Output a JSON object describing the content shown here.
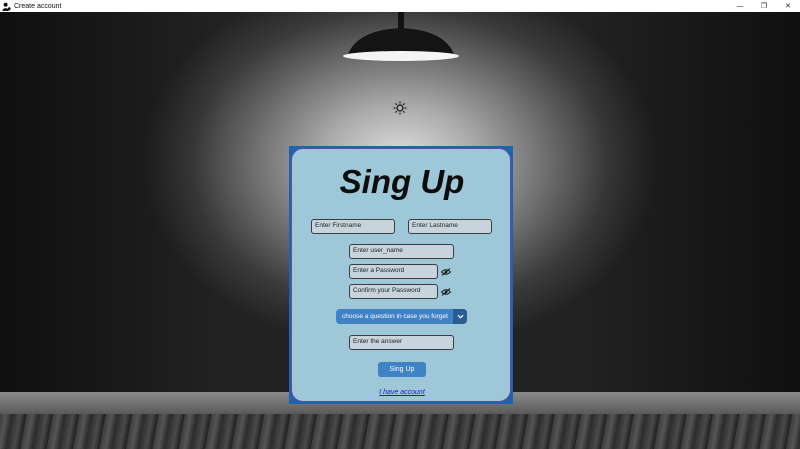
{
  "window": {
    "title": "Create account",
    "controls": {
      "minimize": "—",
      "restore": "❐",
      "close": "✕"
    }
  },
  "icons": {
    "app": "user-icon",
    "theme_toggle": "sun-icon",
    "password_visibility": "eye-slash-icon",
    "dropdown": "chevron-down-icon"
  },
  "colors": {
    "card_border": "#1e63b0",
    "card_bg": "#9ec7d8",
    "accent": "#3f82c6",
    "link": "#1a1ae0"
  },
  "form": {
    "heading": "Sing Up",
    "firstname_placeholder": "Enter Firstname",
    "lastname_placeholder": "Enter Lastname",
    "username_placeholder": "Enter user_name",
    "password_placeholder": "Enter a Password",
    "confirm_placeholder": "Confirm your Password",
    "question_select": "choose a question in case you forget",
    "answer_placeholder": "Enter the answer",
    "submit_label": "Sing Up",
    "login_link": "I have account"
  }
}
